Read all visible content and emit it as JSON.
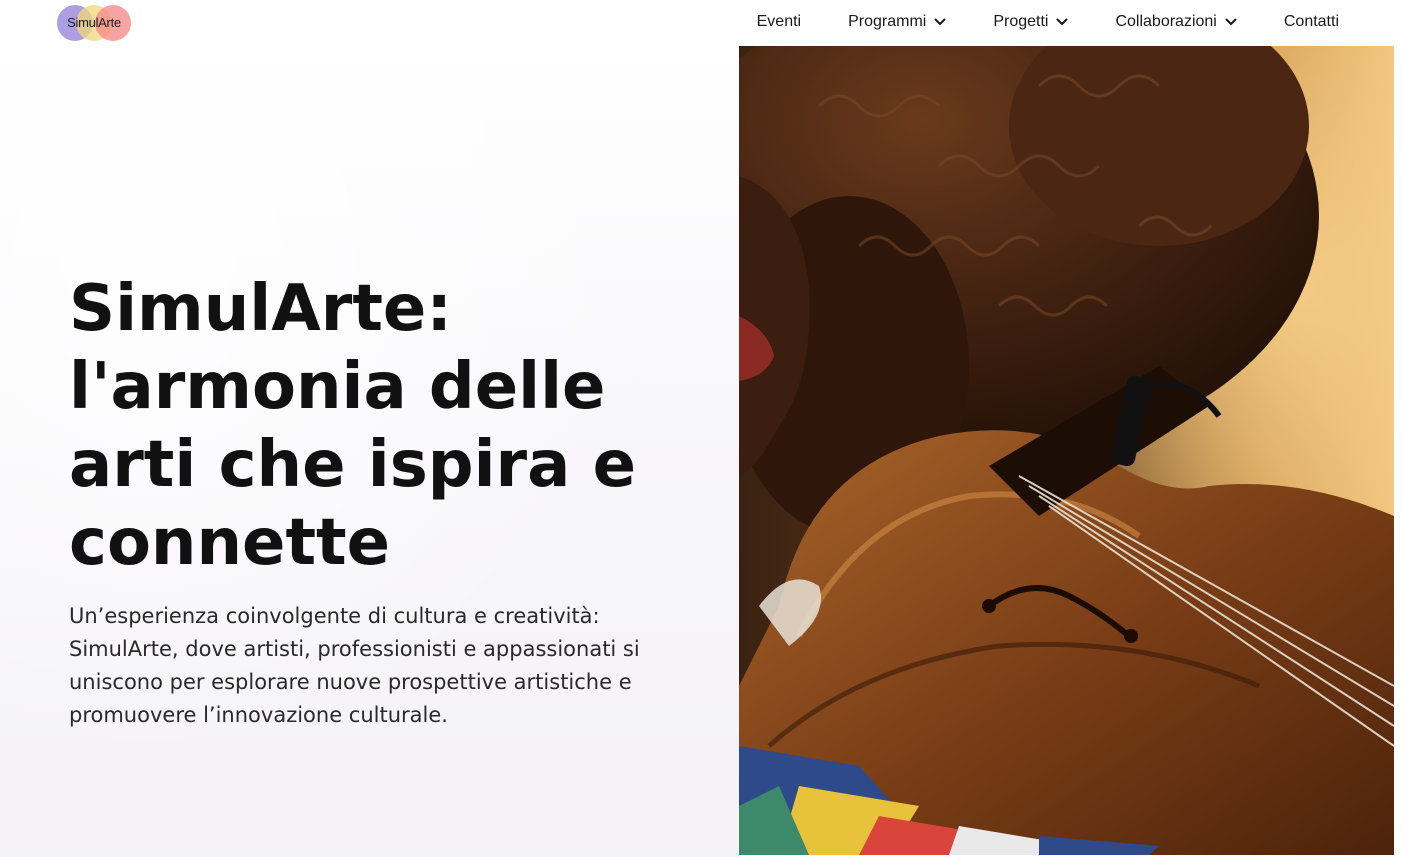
{
  "brand": {
    "logo_text": "SimulArte",
    "colors": [
      "#8f7fd8",
      "#f3d77a",
      "#f48c8c"
    ]
  },
  "nav": {
    "items": [
      {
        "label": "Eventi",
        "has_dropdown": false
      },
      {
        "label": "Programmi",
        "has_dropdown": true
      },
      {
        "label": "Progetti",
        "has_dropdown": true
      },
      {
        "label": "Collaborazioni",
        "has_dropdown": true
      },
      {
        "label": "Contatti",
        "has_dropdown": false
      }
    ],
    "dropdown_icon": "chevron-down-icon"
  },
  "hero": {
    "title_lines": [
      "SimulArte:",
      "l'armonia delle",
      "arti che ispira e",
      "connette"
    ],
    "subtitle_lines": [
      "Un’esperienza coinvolgente di cultura e creatività:",
      "SimulArte, dove artisti, professionisti e appassionati si",
      "uniscono per esplorare nuove prospettive artistiche e",
      "promuovere l’innovazione culturale."
    ],
    "image_subject": "violinist-photo"
  }
}
